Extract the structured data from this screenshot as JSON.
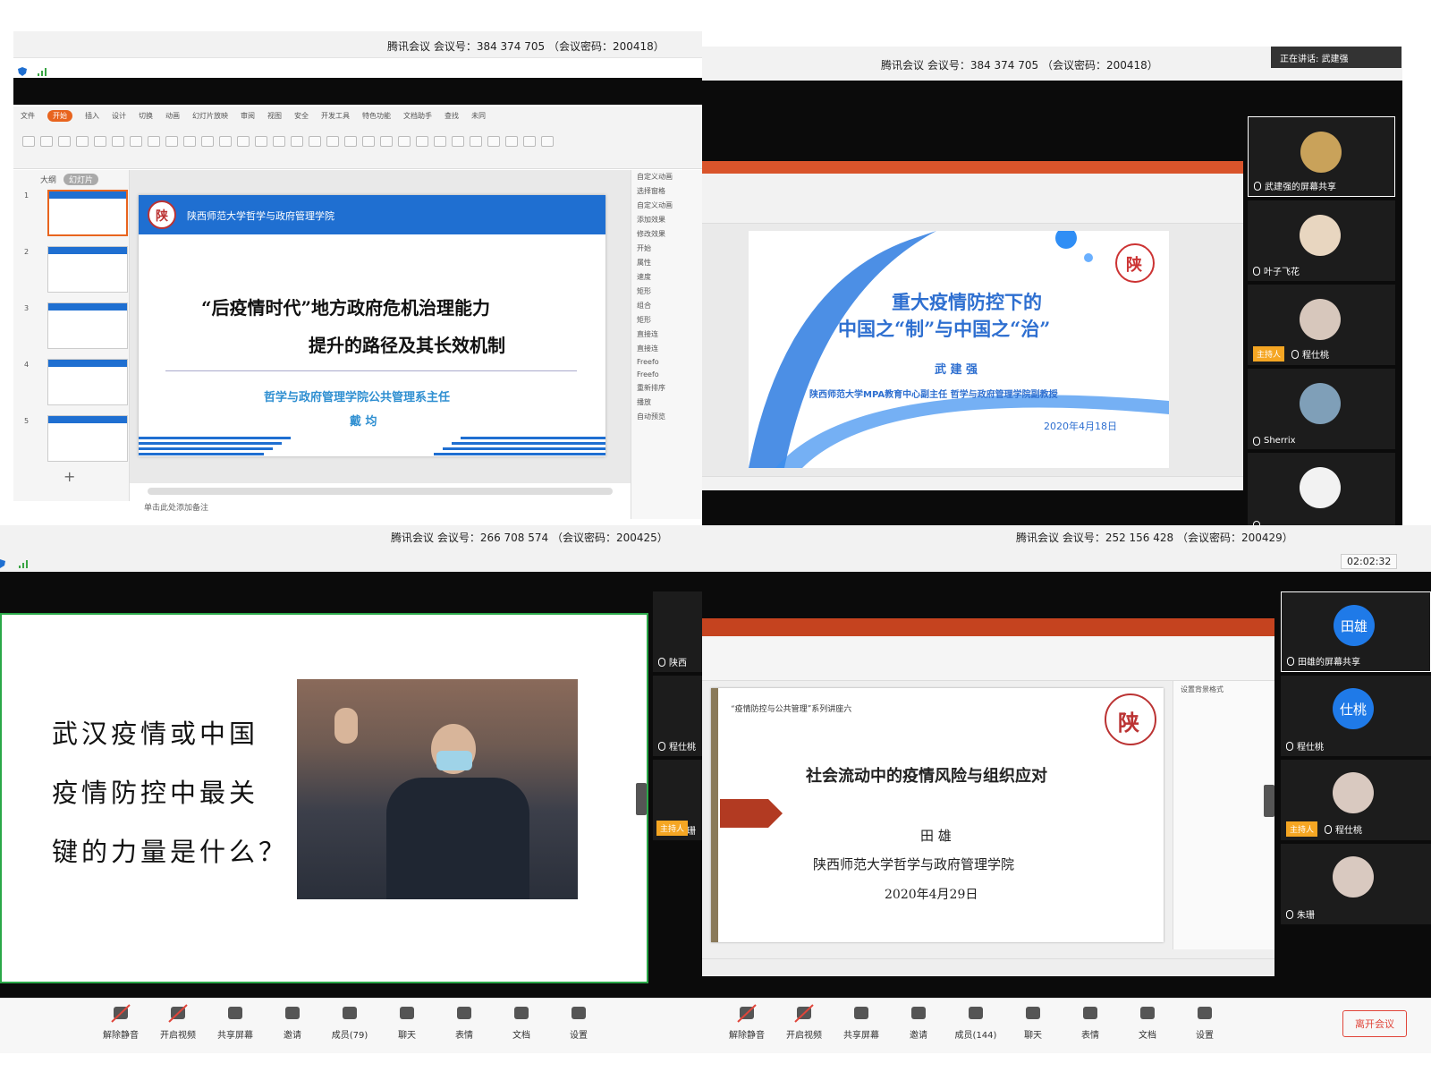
{
  "q1": {
    "meeting_info": "腾讯会议 会议号：384 374 705 （会议密码：200418）",
    "ribbon_tabs": [
      "文件",
      "开始",
      "插入",
      "设计",
      "切换",
      "动画",
      "幻灯片放映",
      "审阅",
      "视图",
      "安全",
      "开发工具",
      "特色功能",
      "文档助手",
      "查找",
      "未同"
    ],
    "active_tab": "开始",
    "pane_tabs": [
      "大纲",
      "幻灯片"
    ],
    "slide_nums": [
      "1",
      "2",
      "3",
      "4",
      "5"
    ],
    "slide": {
      "school": "陕西师范大学哲学与政府管理学院",
      "title_1": "“后疫情时代”地方政府危机治理能力",
      "title_2": "提升的路径及其长效机制",
      "dept": "哲学与政府管理学院公共管理系主任",
      "speaker": "戴  均"
    },
    "notes": "单击此处添加备注",
    "right_panel": [
      "自定义动画",
      "选择窗格",
      "自定义动画",
      "添加效果",
      "修改效果",
      "开始",
      "属性",
      "速度",
      "矩形",
      "组合",
      "矩形",
      "直接连",
      "直接连",
      "Freefo",
      "Freefo",
      "重新排序",
      "播放",
      "自动预览"
    ]
  },
  "q2": {
    "meeting_info": "腾讯会议 会议号：384 374 705 （会议密码：200418）",
    "speaking": "正在讲话: 武建强",
    "slide": {
      "title_1": "重大疫情防控下的",
      "title_2": "中国之“制”与中国之“治”",
      "speaker": "武 建 强",
      "affil": "陕西师范大学MPA教育中心副主任 哲学与政府管理学院副教授",
      "date": "2020年4月18日"
    },
    "participants": [
      {
        "name": "武建强的屏幕共享",
        "host": false
      },
      {
        "name": "叶子飞花",
        "host": false
      },
      {
        "name": "程仕桃",
        "host": true
      },
      {
        "name": "Sherrix",
        "host": false
      },
      {
        "name": "",
        "host": false
      }
    ],
    "host_label": "主持人"
  },
  "q3": {
    "meeting_info": "腾讯会议 会议号：266 708 574 （会议密码：200425）",
    "slide_lines": [
      "武汉疫情或中国",
      "疫情防控中最关",
      "键的力量是什么？"
    ],
    "participants": [
      "陕西",
      "程仕桃",
      "王珊珊"
    ],
    "host_label": "主持人",
    "toolbar": [
      "解除静音",
      "开启视频",
      "共享屏幕",
      "邀请",
      "成员(79)",
      "聊天",
      "表情",
      "文档",
      "设置"
    ]
  },
  "q4": {
    "meeting_info": "腾讯会议 会议号：252 156 428 （会议密码：200429）",
    "timer": "02:02:32",
    "slide": {
      "series": "“疫情防控与公共管理”系列讲座六",
      "title": "社会流动中的疫情风险与组织应对",
      "speaker": "田  雄",
      "school": "陕西师范大学哲学与政府管理学院",
      "date": "2020年4月29日"
    },
    "side_panel_title": "设置背景格式",
    "participants": [
      {
        "avatar_text": "田雄",
        "name": "田雄的屏幕共享",
        "host": false
      },
      {
        "avatar_text": "仕桃",
        "name": "程仕桃",
        "host": false
      },
      {
        "avatar_text": "",
        "name": "程仕桃",
        "host": true
      },
      {
        "avatar_text": "",
        "name": "朱珊",
        "host": false
      }
    ],
    "host_label": "主持人",
    "toolbar": [
      "解除静音",
      "开启视频",
      "共享屏幕",
      "邀请",
      "成员(144)",
      "聊天",
      "表情",
      "文档",
      "设置"
    ],
    "leave": "离开会议"
  },
  "colors": {
    "accent": "#1f6fd1",
    "wps_orange": "#e8641e",
    "host": "#f5a623",
    "leave_red": "#e0453a"
  }
}
